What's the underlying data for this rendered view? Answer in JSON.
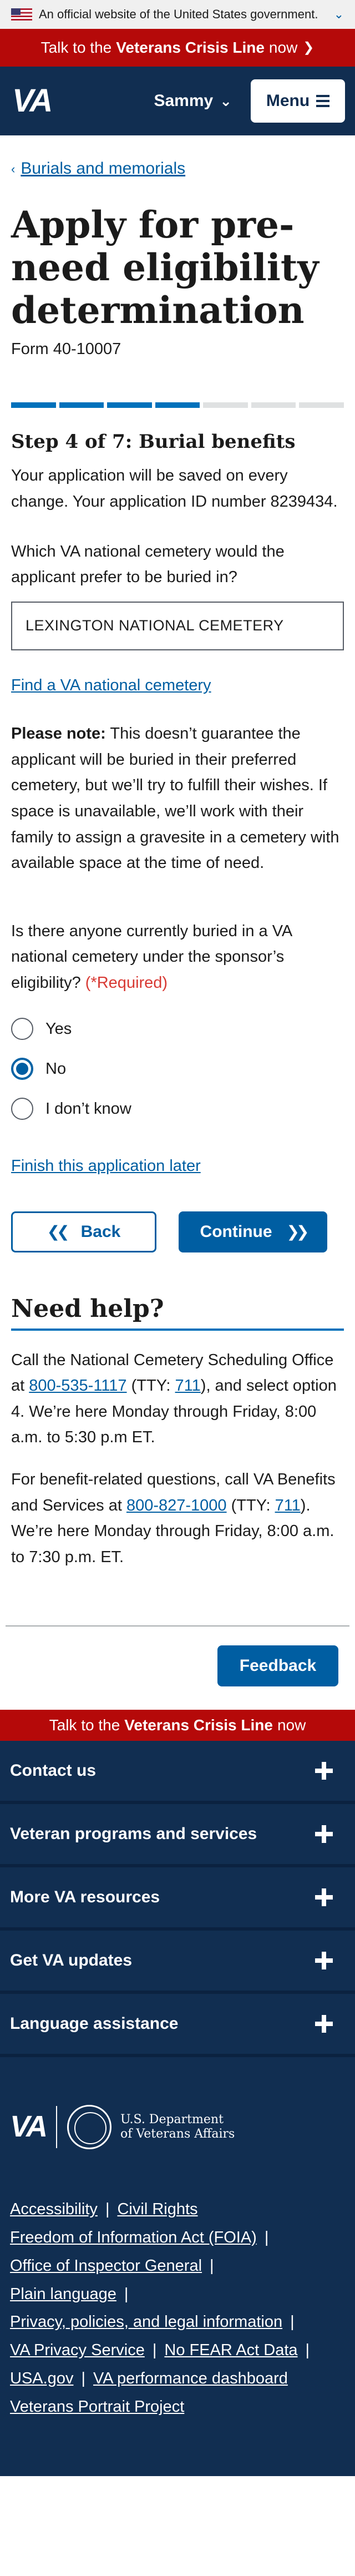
{
  "banner": {
    "text": "An official website of the United States government."
  },
  "crisis_line": {
    "prefix": "Talk to the",
    "bold": "Veterans Crisis Line",
    "suffix": "now"
  },
  "header": {
    "logo": "VA",
    "user_name": "Sammy",
    "menu_label": "Menu"
  },
  "breadcrumb": {
    "label": "Burials and memorials"
  },
  "page": {
    "title": "Apply for pre-need eligibility determination",
    "form_number": "Form 40-10007",
    "progress": {
      "total_steps": 7,
      "completed_steps": 4
    },
    "step_title": "Step 4 of 7: Burial benefits",
    "save_note": "Your application will be saved on every change. Your application  ID number 8239434.",
    "cemetery_question": "Which VA national cemetery would the applicant prefer to be buried in?",
    "cemetery_value": "LEXINGTON NATIONAL CEMETERY",
    "find_cemetery_link": "Find a VA national cemetery",
    "note_label": "Please note:",
    "note_text": " This doesn’t guarantee the applicant will be buried in their preferred cemetery, but we’ll try to fulfill their wishes. If space is unavailable, we’ll work with their family to assign a gravesite in a cemetery with available space at the time of need.",
    "radio_question": "Is there anyone currently buried in a VA national cemetery under the sponsor’s eligibility?",
    "required_label": "(*Required)",
    "radio_options": [
      "Yes",
      "No",
      "I don’t know"
    ],
    "radio_selected": "No",
    "finish_later_link": "Finish this application later",
    "back_label": "Back",
    "continue_label": "Continue"
  },
  "need_help": {
    "heading": "Need help?",
    "p1_a": "Call the National Cemetery Scheduling Office at ",
    "p1_phone": "800-535-1117",
    "p1_b": " (TTY: ",
    "p1_tty": "711",
    "p1_c": "), and select option 4. We’re here Monday through Friday, 8:00 a.m. to 5:30 p.m ET.",
    "p2_a": "For benefit-related questions, call VA Benefits and Services at ",
    "p2_phone": "800-827-1000",
    "p2_b": " (TTY: ",
    "p2_tty": "711",
    "p2_c": "). We’re here Monday through Friday, 8:00 a.m. to 7:30 p.m. ET."
  },
  "feedback_label": "Feedback",
  "footer": {
    "accordion": [
      "Contact us",
      "Veteran programs and services",
      "More VA resources",
      "Get VA updates",
      "Language assistance"
    ],
    "brand_va": "VA",
    "dept_line1": "U.S. Department",
    "dept_line2": "of Veterans Affairs",
    "links": {
      "accessibility": "Accessibility",
      "civil_rights": "Civil Rights",
      "foia": "Freedom of Information Act (FOIA)",
      "oig": "Office of Inspector General",
      "plain_language": "Plain language",
      "privacy": "Privacy, policies, and legal information",
      "privacy_service": "VA Privacy Service",
      "no_fear": "No FEAR Act Data",
      "usa_gov": "USA.gov",
      "dashboard": "VA performance dashboard",
      "portrait": "Veterans Portrait Project"
    }
  },
  "colors": {
    "primary": "#005ea2",
    "header_bg": "#112e51",
    "crisis_red": "#b50909",
    "required_red": "#d83933",
    "progress_done": "#0071bb",
    "progress_todo": "#dfe1e2"
  },
  "icons": [
    "us-flag-icon",
    "chevron-down-icon",
    "arrow-right-icon",
    "hamburger-icon",
    "chevron-left-icon",
    "double-chevron-left-icon",
    "double-chevron-right-icon",
    "plus-icon",
    "va-seal-icon"
  ]
}
